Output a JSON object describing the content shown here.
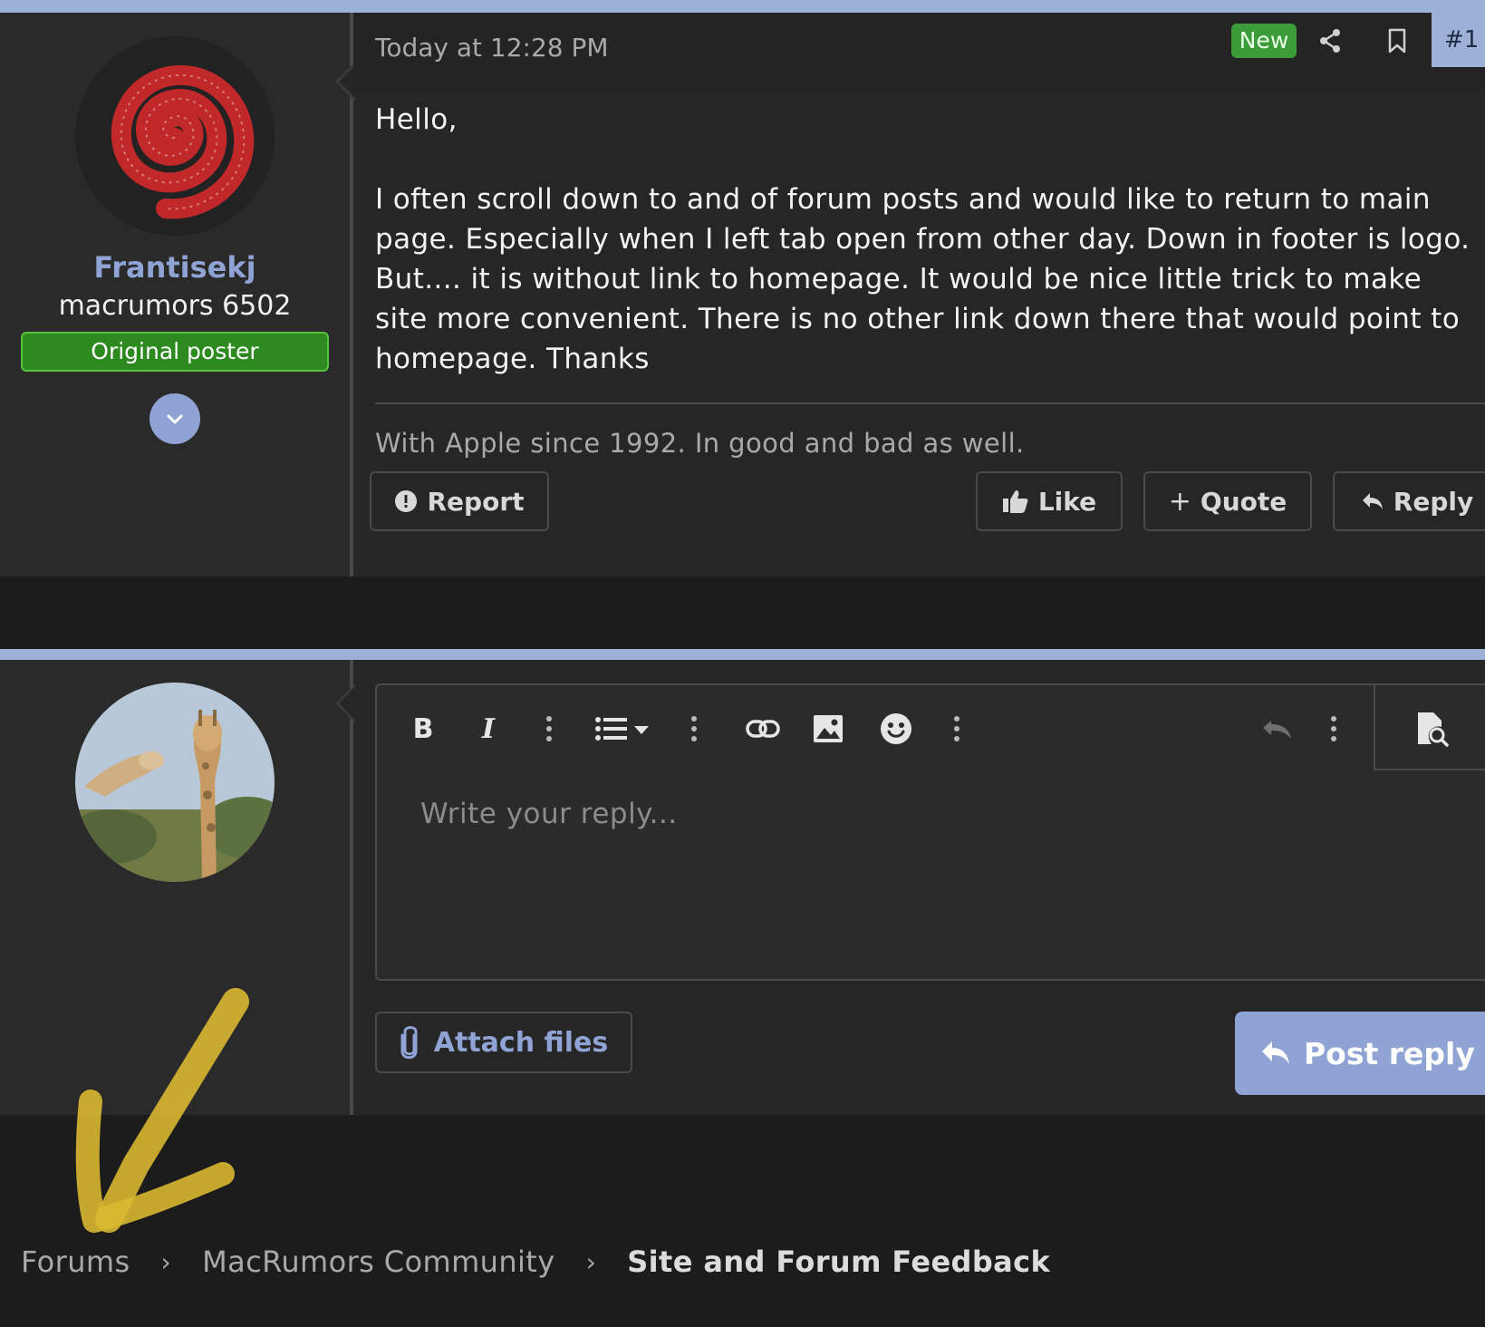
{
  "post": {
    "timestamp": "Today at 12:28 PM",
    "new_badge": "New",
    "post_number": "#1",
    "user": {
      "name": "Frantisekj",
      "title": "macrumors 6502",
      "badge": "Original poster"
    },
    "body": [
      "Hello,",
      "I often scroll down to and of forum posts and would like to return to main page. Especially when I left tab open from other day. Down in footer is logo. But.... it is without link to homepage. It would be nice little trick to make site more convenient. There is no other link down there that would point to homepage. Thanks"
    ],
    "signature": "With Apple since 1992. In good and bad as well.",
    "actions": {
      "report": "Report",
      "like": "Like",
      "quote": "Quote",
      "reply": "Reply"
    }
  },
  "reply_editor": {
    "placeholder": "Write your reply...",
    "toolbar_icons": [
      "bold-icon",
      "italic-icon",
      "more-icon",
      "list-icon",
      "more-icon",
      "link-icon",
      "image-icon",
      "smiley-icon",
      "more-icon",
      "undo-icon",
      "more-icon",
      "preview-icon"
    ],
    "attach_label": "Attach files",
    "post_reply_label": "Post reply"
  },
  "breadcrumb": [
    {
      "label": "Forums"
    },
    {
      "label": "MacRumors Community"
    },
    {
      "label": "Site and Forum Feedback"
    }
  ],
  "colors": {
    "accent": "#9db0d6",
    "background": "#1c1c1d",
    "panel": "#262627",
    "new_badge": "#3c9c3a",
    "op_badge": "#2c8a1f",
    "annotation": "#d9b832"
  }
}
